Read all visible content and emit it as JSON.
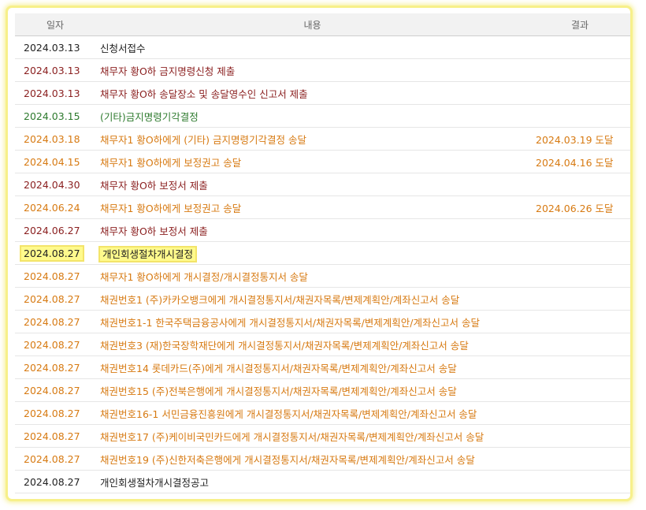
{
  "table": {
    "headers": {
      "date": "일자",
      "content": "내용",
      "result": "결과"
    },
    "rows": [
      {
        "date": "2024.03.13",
        "content": "신청서접수",
        "result": "",
        "color": "black",
        "highlight": false
      },
      {
        "date": "2024.03.13",
        "content": "채무자 황O하 금지명령신청 제출",
        "result": "",
        "color": "red",
        "highlight": false
      },
      {
        "date": "2024.03.13",
        "content": "채무자 황O하 송달장소 및 송달영수인 신고서 제출",
        "result": "",
        "color": "red",
        "highlight": false
      },
      {
        "date": "2024.03.15",
        "content": "(기타)금지명령기각결정",
        "result": "",
        "color": "green",
        "highlight": false
      },
      {
        "date": "2024.03.18",
        "content": "채무자1 황O하에게 (기타) 금지명령기각결정 송달",
        "result": "2024.03.19 도달",
        "color": "orange",
        "highlight": false
      },
      {
        "date": "2024.04.15",
        "content": "채무자1 황O하에게 보정권고 송달",
        "result": "2024.04.16 도달",
        "color": "orange",
        "highlight": false
      },
      {
        "date": "2024.04.30",
        "content": "채무자 황O하 보정서 제출",
        "result": "",
        "color": "red",
        "highlight": false
      },
      {
        "date": "2024.06.24",
        "content": "채무자1 황O하에게 보정권고 송달",
        "result": "2024.06.26 도달",
        "color": "orange",
        "highlight": false
      },
      {
        "date": "2024.06.27",
        "content": "채무자 황O하 보정서 제출",
        "result": "",
        "color": "red",
        "highlight": false
      },
      {
        "date": "2024.08.27",
        "content": "개인회생절차개시결정",
        "result": "",
        "color": "black",
        "highlight": true
      },
      {
        "date": "2024.08.27",
        "content": "채무자1 황O하에게 개시결정/개시결정통지서 송달",
        "result": "",
        "color": "orange",
        "highlight": false
      },
      {
        "date": "2024.08.27",
        "content": "채권번호1 (주)카카오뱅크에게 개시결정통지서/채권자목록/변제계획안/계좌신고서 송달",
        "result": "",
        "color": "orange",
        "highlight": false
      },
      {
        "date": "2024.08.27",
        "content": "채권번호1-1 한국주택금융공사에게 개시결정통지서/채권자목록/변제계획안/계좌신고서 송달",
        "result": "",
        "color": "orange",
        "highlight": false
      },
      {
        "date": "2024.08.27",
        "content": "채권번호3 (재)한국장학재단에게 개시결정통지서/채권자목록/변제계획안/계좌신고서 송달",
        "result": "",
        "color": "orange",
        "highlight": false
      },
      {
        "date": "2024.08.27",
        "content": "채권번호14 롯데카드(주)에게 개시결정통지서/채권자목록/변제계획안/계좌신고서 송달",
        "result": "",
        "color": "orange",
        "highlight": false
      },
      {
        "date": "2024.08.27",
        "content": "채권번호15 (주)전북은행에게 개시결정통지서/채권자목록/변제계획안/계좌신고서 송달",
        "result": "",
        "color": "orange",
        "highlight": false
      },
      {
        "date": "2024.08.27",
        "content": "채권번호16-1 서민금융진흥원에게 개시결정통지서/채권자목록/변제계획안/계좌신고서 송달",
        "result": "",
        "color": "orange",
        "highlight": false
      },
      {
        "date": "2024.08.27",
        "content": "채권번호17 (주)케이비국민카드에게 개시결정통지서/채권자목록/변제계획안/계좌신고서 송달",
        "result": "",
        "color": "orange",
        "highlight": false
      },
      {
        "date": "2024.08.27",
        "content": "채권번호19 (주)신한저축은행에게 개시결정통지서/채권자목록/변제계획안/계좌신고서 송달",
        "result": "",
        "color": "orange",
        "highlight": false
      },
      {
        "date": "2024.08.27",
        "content": "개인회생절차개시결정공고",
        "result": "",
        "color": "black",
        "highlight": false
      }
    ]
  },
  "colors": {
    "black": "#222222",
    "red": "#8a1e1e",
    "green": "#2d7a2d",
    "orange": "#d77a12",
    "highlight_bg": "#fffa8c",
    "frame_glow": "#f7f08a"
  }
}
